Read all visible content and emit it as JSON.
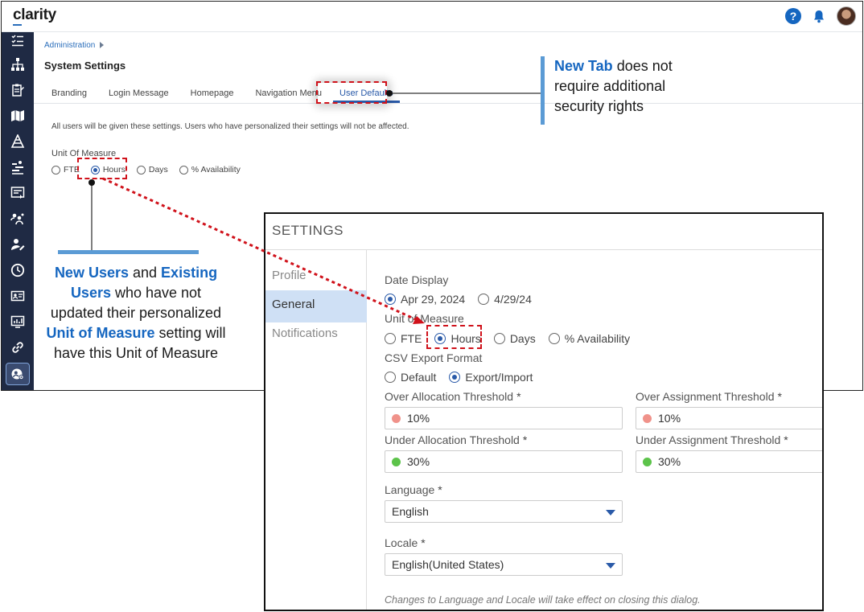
{
  "app": {
    "logo": "clarity",
    "breadcrumb": "Administration",
    "page_title": "System Settings",
    "tabs": [
      {
        "label": "Branding"
      },
      {
        "label": "Login Message"
      },
      {
        "label": "Homepage"
      },
      {
        "label": "Navigation Menu"
      },
      {
        "label": "User Defaults",
        "active": true
      }
    ],
    "info_text": "All users will be given these settings. Users who have personalized their settings will not be affected.",
    "uom_label": "Unit Of Measure",
    "uom_options": [
      "FTE",
      "Hours",
      "Days",
      "% Availability"
    ],
    "uom_selected": "Hours",
    "top_icons": [
      "help-icon",
      "bell-icon",
      "avatar"
    ],
    "sidebar_icons": [
      "checklist-icon",
      "hierarchy-icon",
      "clipboard-icon",
      "map-icon",
      "org-chart-icon",
      "roadmap-icon",
      "list-icon",
      "team-icon",
      "user-edit-icon",
      "clock-icon",
      "id-card-icon",
      "chart-icon",
      "link-icon",
      "admin-settings-icon"
    ]
  },
  "callouts": {
    "tab": {
      "lead": "New Tab",
      "rest1": " does not",
      "line2": "require additional",
      "line3": "security rights"
    },
    "users": {
      "p1": "New Users",
      "p2": " and ",
      "p3": "Existing",
      "p4": "Users",
      "p5": " who have not",
      "p6": "updated their personalized",
      "p7": "Unit of Measure",
      "p8": " setting will",
      "p9": "have this Unit of Measure"
    },
    "colors": {
      "dash": "#d0121b",
      "bar": "#5b9bd5",
      "highlight": "#1566c0"
    }
  },
  "dialog": {
    "title": "SETTINGS",
    "nav": [
      {
        "label": "Profile"
      },
      {
        "label": "General",
        "active": true
      },
      {
        "label": "Notifications"
      }
    ],
    "date_display_label": "Date Display",
    "date_options": [
      "Apr 29, 2024",
      "4/29/24"
    ],
    "date_selected": "Apr 29, 2024",
    "uom_label": "Unit of Measure",
    "uom_options": [
      "FTE",
      "Hours",
      "Days",
      "% Availability"
    ],
    "uom_selected": "Hours",
    "csv_label": "CSV Export Format",
    "csv_options": [
      "Default",
      "Export/Import"
    ],
    "csv_selected": "Export/Import",
    "over_alloc_label": "Over Allocation Threshold",
    "over_alloc_value": "10%",
    "over_assign_label": "Over Assignment Threshold",
    "over_assign_value": "10%",
    "under_alloc_label": "Under Allocation Threshold",
    "under_alloc_value": "30%",
    "under_assign_label": "Under Assignment Threshold",
    "under_assign_value": "30%",
    "required_mark": "*",
    "language_label": "Language",
    "language_value": "English",
    "locale_label": "Locale",
    "locale_value": "English(United States)",
    "note": "Changes to Language and Locale will take effect on closing this dialog.",
    "colors": {
      "over_dot": "#f0928a",
      "under_dot": "#5cc34a",
      "accent": "#2a5aa8",
      "active_nav": "#cfe0f5"
    }
  }
}
